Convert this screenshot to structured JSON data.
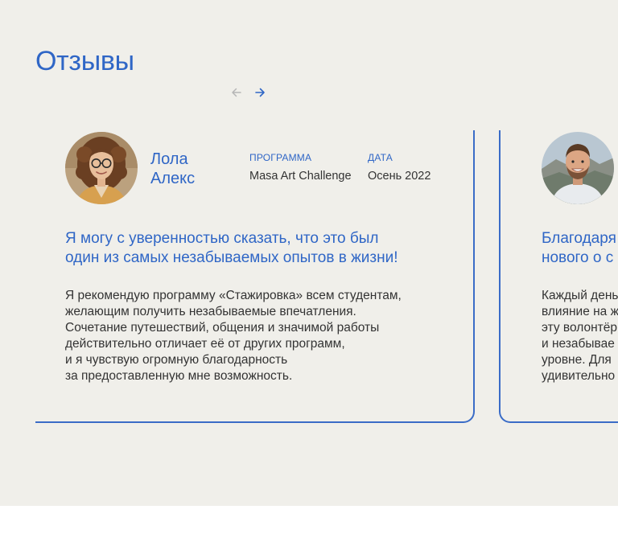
{
  "section": {
    "title": "Отзывы",
    "nav": {
      "prev_icon": "arrow-left-icon",
      "next_icon": "arrow-right-icon"
    }
  },
  "colors": {
    "accent": "#2f66c6",
    "background": "#f0efea",
    "border": "#3a6cc7",
    "text": "#333333"
  },
  "testimonials": [
    {
      "name_lines": [
        "Лола",
        "Алекс"
      ],
      "program_label": "ПРОГРАММА",
      "program_value": "Masa Art Challenge",
      "date_label": "ДАТА",
      "date_value": "Осень 2022",
      "quote_lines": [
        "Я могу с уверенностью сказать, что это был",
        "один из самых незабываемых опытов в жизни!"
      ],
      "body_lines": [
        "Я рекомендую программу «Стажировка» всем студентам,",
        "желающим получить незабываемые впечатления.",
        "Сочетание путешествий, общения и значимой работы",
        "действительно отличает её от других программ,",
        "и я чувствую огромную благодарность",
        "за предоставленную мне возможность."
      ]
    },
    {
      "quote_lines": [
        "Благодаря",
        "нового о с"
      ],
      "body_lines": [
        "Каждый день",
        "влияние на ж",
        "эту волонтёр",
        "и незабывае",
        "уровне. Для",
        "удивительно"
      ]
    }
  ]
}
